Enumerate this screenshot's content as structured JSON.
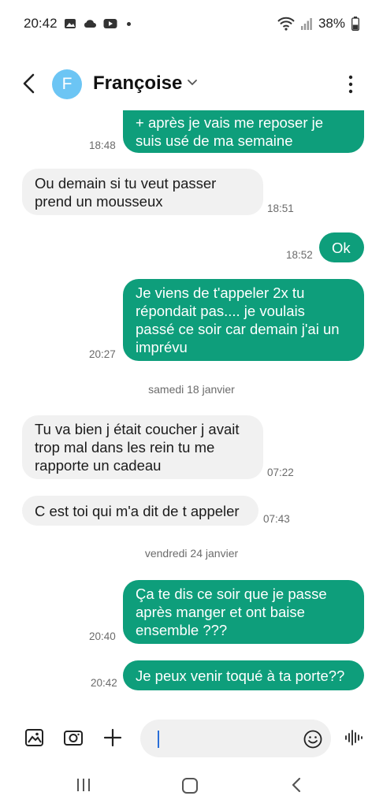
{
  "status": {
    "time": "20:42",
    "battery": "38%",
    "icons": [
      "gallery-icon",
      "cloud-icon",
      "youtube-icon",
      "wifi-icon",
      "signal-icon",
      "battery-icon"
    ]
  },
  "header": {
    "avatar_initial": "F",
    "contact_name": "Françoise",
    "avatar_color": "#6cc5f4"
  },
  "messages": [
    {
      "dir": "out",
      "lines": [
        "+ après je vais me reposer je",
        "suis usé de ma semaine"
      ],
      "time": "18:48"
    },
    {
      "dir": "in",
      "lines": [
        "Ou demain si tu veut passer",
        "prend un mousseux"
      ],
      "time": "18:51"
    },
    {
      "dir": "out",
      "lines": [
        "Ok"
      ],
      "time": "18:52"
    },
    {
      "dir": "out",
      "lines": [
        "Je viens de t'appeler 2x tu",
        "répondait pas.... je voulais",
        "passé ce soir car demain j'ai un",
        "imprévu"
      ],
      "time": "20:27"
    },
    {
      "dir": "date",
      "text": "samedi 18 janvier"
    },
    {
      "dir": "in",
      "lines": [
        "Tu va bien j était coucher j avait",
        "trop mal dans les rein tu me",
        "rapporte un cadeau"
      ],
      "time": "07:22"
    },
    {
      "dir": "in",
      "lines": [
        "C est toi qui m'a dit de t appeler"
      ],
      "time": "07:43"
    },
    {
      "dir": "date",
      "text": "vendredi 24 janvier"
    },
    {
      "dir": "out",
      "lines": [
        "Ça te dis ce soir que je passe",
        "après manger et ont baise",
        "ensemble ???"
      ],
      "time": "20:40"
    },
    {
      "dir": "out",
      "lines": [
        "Je peux venir toqué à ta porte??"
      ],
      "time": "20:42"
    }
  ],
  "composer": {
    "input_value": "",
    "icons": [
      "gallery-icon",
      "camera-icon",
      "plus-icon",
      "emoji-icon",
      "voice-icon"
    ]
  },
  "colors": {
    "outgoing_bubble": "#0e9e7b",
    "incoming_bubble": "#f1f1f1",
    "caret": "#2a6fd8"
  }
}
